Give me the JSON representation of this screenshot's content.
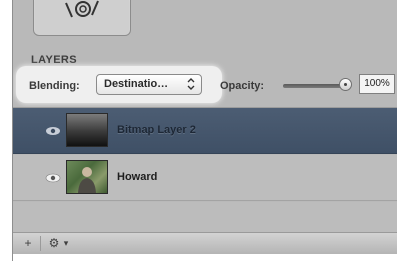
{
  "panel": {
    "section_title": "LAYERS"
  },
  "blending": {
    "label": "Blending:",
    "selected_value": "Destinatio…"
  },
  "opacity": {
    "label": "Opacity:",
    "value": "100%",
    "slider_level": 1.0
  },
  "layers": [
    {
      "name": "Bitmap Layer 2",
      "selected": true,
      "visible": true
    },
    {
      "name": "Howard",
      "selected": false,
      "visible": true
    }
  ],
  "bottom_bar": {
    "add_label": "+",
    "gear_label": "⚙",
    "gear_menu_label": "▾"
  },
  "colors": {
    "selected_row": "#44556b",
    "panel_background": "#b9b9b9",
    "callout_highlight": "#efefef"
  },
  "icons": {
    "tool": "tool-icon",
    "visibility": "eye-icon",
    "add": "plus-icon",
    "settings": "gear-icon",
    "dropdown": "chevron-updown-icon"
  }
}
